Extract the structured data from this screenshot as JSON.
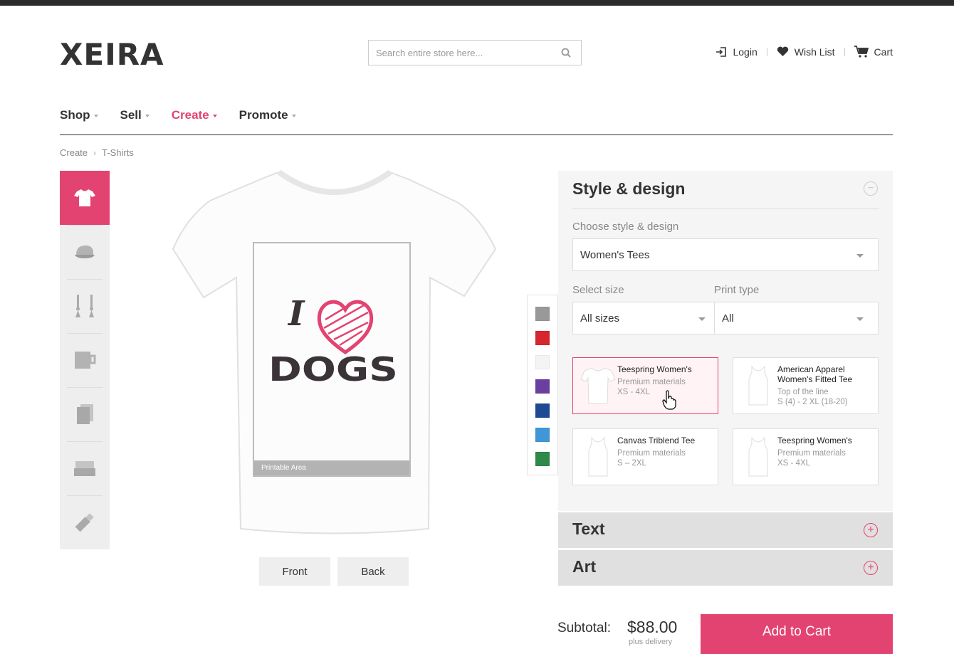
{
  "header": {
    "logo": "XEIRA",
    "search_placeholder": "Search entire store here...",
    "links": {
      "login": "Login",
      "wishlist": "Wish List",
      "cart": "Cart"
    }
  },
  "nav": {
    "items": [
      {
        "label": "Shop",
        "active": false
      },
      {
        "label": "Sell",
        "active": false
      },
      {
        "label": "Create",
        "active": true
      },
      {
        "label": "Promote",
        "active": false
      }
    ]
  },
  "breadcrumb": [
    "Create",
    "T-Shirts"
  ],
  "categories": [
    {
      "icon": "tshirt-icon",
      "active": true
    },
    {
      "icon": "cap-icon",
      "active": false
    },
    {
      "icon": "earrings-icon",
      "active": false
    },
    {
      "icon": "mug-icon",
      "active": false
    },
    {
      "icon": "phone-case-icon",
      "active": false
    },
    {
      "icon": "bed-icon",
      "active": false
    },
    {
      "icon": "usb-drive-icon",
      "active": false
    }
  ],
  "product": {
    "design_line1": "I",
    "design_line2": "DOGS",
    "printable_label": "Printable Area",
    "views": {
      "front": "Front",
      "back": "Back"
    }
  },
  "colors": [
    "#999999",
    "#d8262f",
    "#f4f4f4",
    "#6a3fa0",
    "#1f4a93",
    "#3f97d7",
    "#2f8a4a"
  ],
  "style_panel": {
    "title": "Style & design",
    "choose_label": "Choose style & design",
    "choose_value": "Women's Tees",
    "size_label": "Select size",
    "size_value": "All sizes",
    "print_label": "Print type",
    "print_value": "All",
    "styles": [
      {
        "name": "Teespring Women's",
        "sub1": "Premium materials",
        "sub2": "XS - 4XL",
        "selected": true
      },
      {
        "name": "American Apparel Women's Fitted Tee",
        "sub1": "Top of the line",
        "sub2": "S (4) - 2 XL (18-20)",
        "selected": false
      },
      {
        "name": "Canvas Triblend Tee",
        "sub1": "Premium materials",
        "sub2": "S – 2XL",
        "selected": false
      },
      {
        "name": "Teespring Women's",
        "sub1": "Premium materials",
        "sub2": "XS - 4XL",
        "selected": false
      }
    ]
  },
  "accordion": {
    "text": "Text",
    "art": "Art"
  },
  "checkout": {
    "subtotal_label": "Subtotal:",
    "subtotal_value": "$88.00",
    "subtotal_note": "plus delivery",
    "add_to_cart": "Add to Cart"
  },
  "theme": {
    "accent": "#e34370",
    "panel_bg": "#f5f5f5",
    "accordion_bg": "#e0e0e0"
  }
}
